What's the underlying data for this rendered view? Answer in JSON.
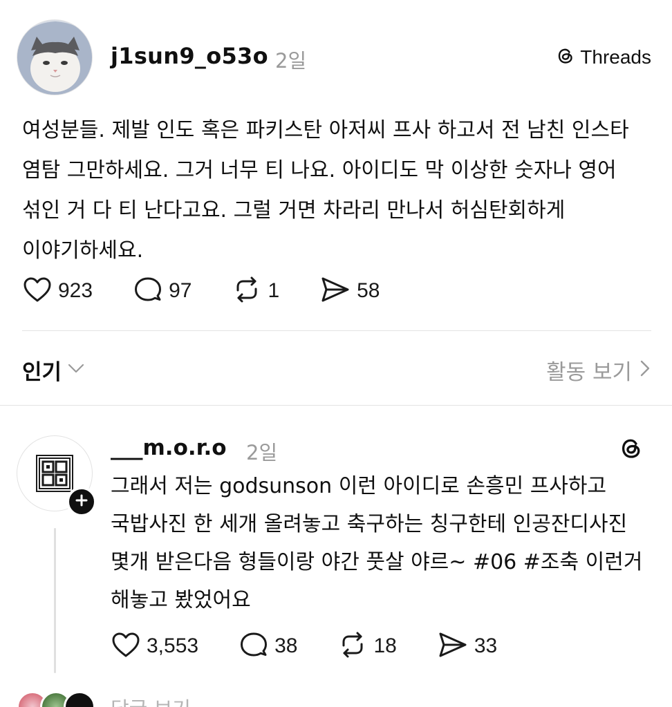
{
  "post": {
    "username": "j1sun9_o53o",
    "time": "2일",
    "badge_label": "Threads",
    "text": "여성분들. 제발 인도 혹은 파키스탄 아저씨 프사 하고서 전 남친 인스타 염탐 그만하세요. 그거 너무 티 나요. 아이디도 막 이상한 숫자나 영어 섞인 거 다 티 난다고요. 그럴 거면 차라리 만나서 허심탄회하게 이야기하세요.",
    "likes": "923",
    "comments": "97",
    "reposts": "1",
    "shares": "58"
  },
  "sort": {
    "label": "인기",
    "activity_label": "활동 보기"
  },
  "reply": {
    "username": "___m.o.r.o",
    "time": "2일",
    "text": "그래서 저는 godsunson 이런 아이디로 손흥민 프사하고 국밥사진 한 세개 올려놓고 축구하는 칭구한테 인공잔디사진 몇개 받은다음 형들이랑 야간 풋살 야르~ #06 #조축  이런거 해놓고 봤었어요",
    "likes": "3,553",
    "comments": "38",
    "reposts": "18",
    "shares": "33"
  },
  "more_replies_label": "답글 보기",
  "icons": {
    "like": "heart-icon",
    "comment": "comment-bubble-icon",
    "repost": "repost-icon",
    "share": "share-send-icon",
    "threads": "threads-logo-icon",
    "plus": "plus-icon",
    "chevron_down": "chevron-down-icon",
    "chevron_right": "chevron-right-icon"
  }
}
